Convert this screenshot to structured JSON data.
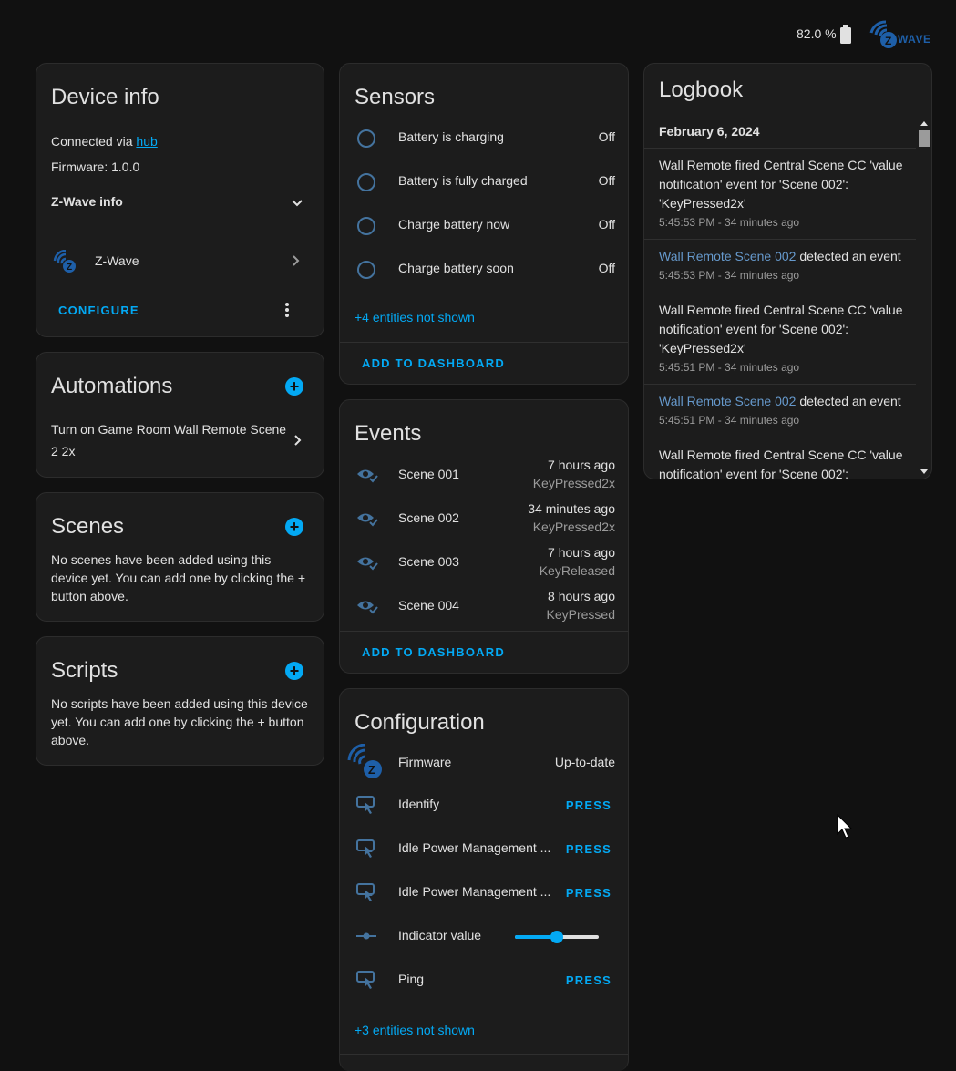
{
  "topbar": {
    "battery": "82.0 %",
    "logo_text": "WAVE"
  },
  "device_info": {
    "title": "Device info",
    "connected_prefix": "Connected via ",
    "connected_link": "hub",
    "firmware": "Firmware: 1.0.0",
    "zwave_info": "Z-Wave info",
    "integration": "Z-Wave",
    "configure": "CONFIGURE"
  },
  "automations": {
    "title": "Automations",
    "item": "Turn on Game Room Wall Remote Scene 2 2x"
  },
  "scenes": {
    "title": "Scenes",
    "empty": "No scenes have been added using this device yet. You can add one by clicking the + button above."
  },
  "scripts": {
    "title": "Scripts",
    "empty": "No scripts have been added using this device yet. You can add one by clicking the + button above."
  },
  "sensors": {
    "title": "Sensors",
    "rows": [
      {
        "name": "Battery is charging",
        "state": "Off"
      },
      {
        "name": "Battery is fully charged",
        "state": "Off"
      },
      {
        "name": "Charge battery now",
        "state": "Off"
      },
      {
        "name": "Charge battery soon",
        "state": "Off"
      }
    ],
    "more": "+4 entities not shown",
    "add": "ADD TO DASHBOARD"
  },
  "events": {
    "title": "Events",
    "rows": [
      {
        "name": "Scene 001",
        "time": "7 hours ago",
        "type": "KeyPressed2x"
      },
      {
        "name": "Scene 002",
        "time": "34 minutes ago",
        "type": "KeyPressed2x"
      },
      {
        "name": "Scene 003",
        "time": "7 hours ago",
        "type": "KeyReleased"
      },
      {
        "name": "Scene 004",
        "time": "8 hours ago",
        "type": "KeyPressed"
      }
    ],
    "add": "ADD TO DASHBOARD"
  },
  "configuration": {
    "title": "Configuration",
    "rows": [
      {
        "name": "Firmware",
        "value": "Up-to-date"
      },
      {
        "name": "Identify",
        "value": "PRESS"
      },
      {
        "name": "Idle Power Management ...",
        "value": "PRESS"
      },
      {
        "name": "Idle Power Management ...",
        "value": "PRESS"
      },
      {
        "name": "Indicator value",
        "value": ""
      },
      {
        "name": "Ping",
        "value": "PRESS"
      }
    ],
    "slider_level": 0.5,
    "more": "+3 entities not shown"
  },
  "logbook": {
    "title": "Logbook",
    "date": "February 6, 2024",
    "entries": [
      {
        "text": "Wall Remote fired Central Scene CC 'value notification' event for 'Scene 002': 'KeyPressed2x'",
        "time": "5:45:53 PM - 34 minutes ago"
      },
      {
        "link": "Wall Remote Scene 002",
        "text": " detected an event",
        "time": "5:45:53 PM - 34 minutes ago"
      },
      {
        "text": "Wall Remote fired Central Scene CC 'value notification' event for 'Scene 002': 'KeyPressed2x'",
        "time": "5:45:51 PM - 34 minutes ago"
      },
      {
        "link": "Wall Remote Scene 002",
        "text": " detected an event",
        "time": "5:45:51 PM - 34 minutes ago"
      },
      {
        "text": "Wall Remote fired Central Scene CC 'value notification' event for 'Scene 002':",
        "time": ""
      }
    ]
  },
  "colors": {
    "accent": "#03a9f4",
    "icon": "#44739e",
    "card": "#1c1c1c",
    "background": "#111111"
  }
}
